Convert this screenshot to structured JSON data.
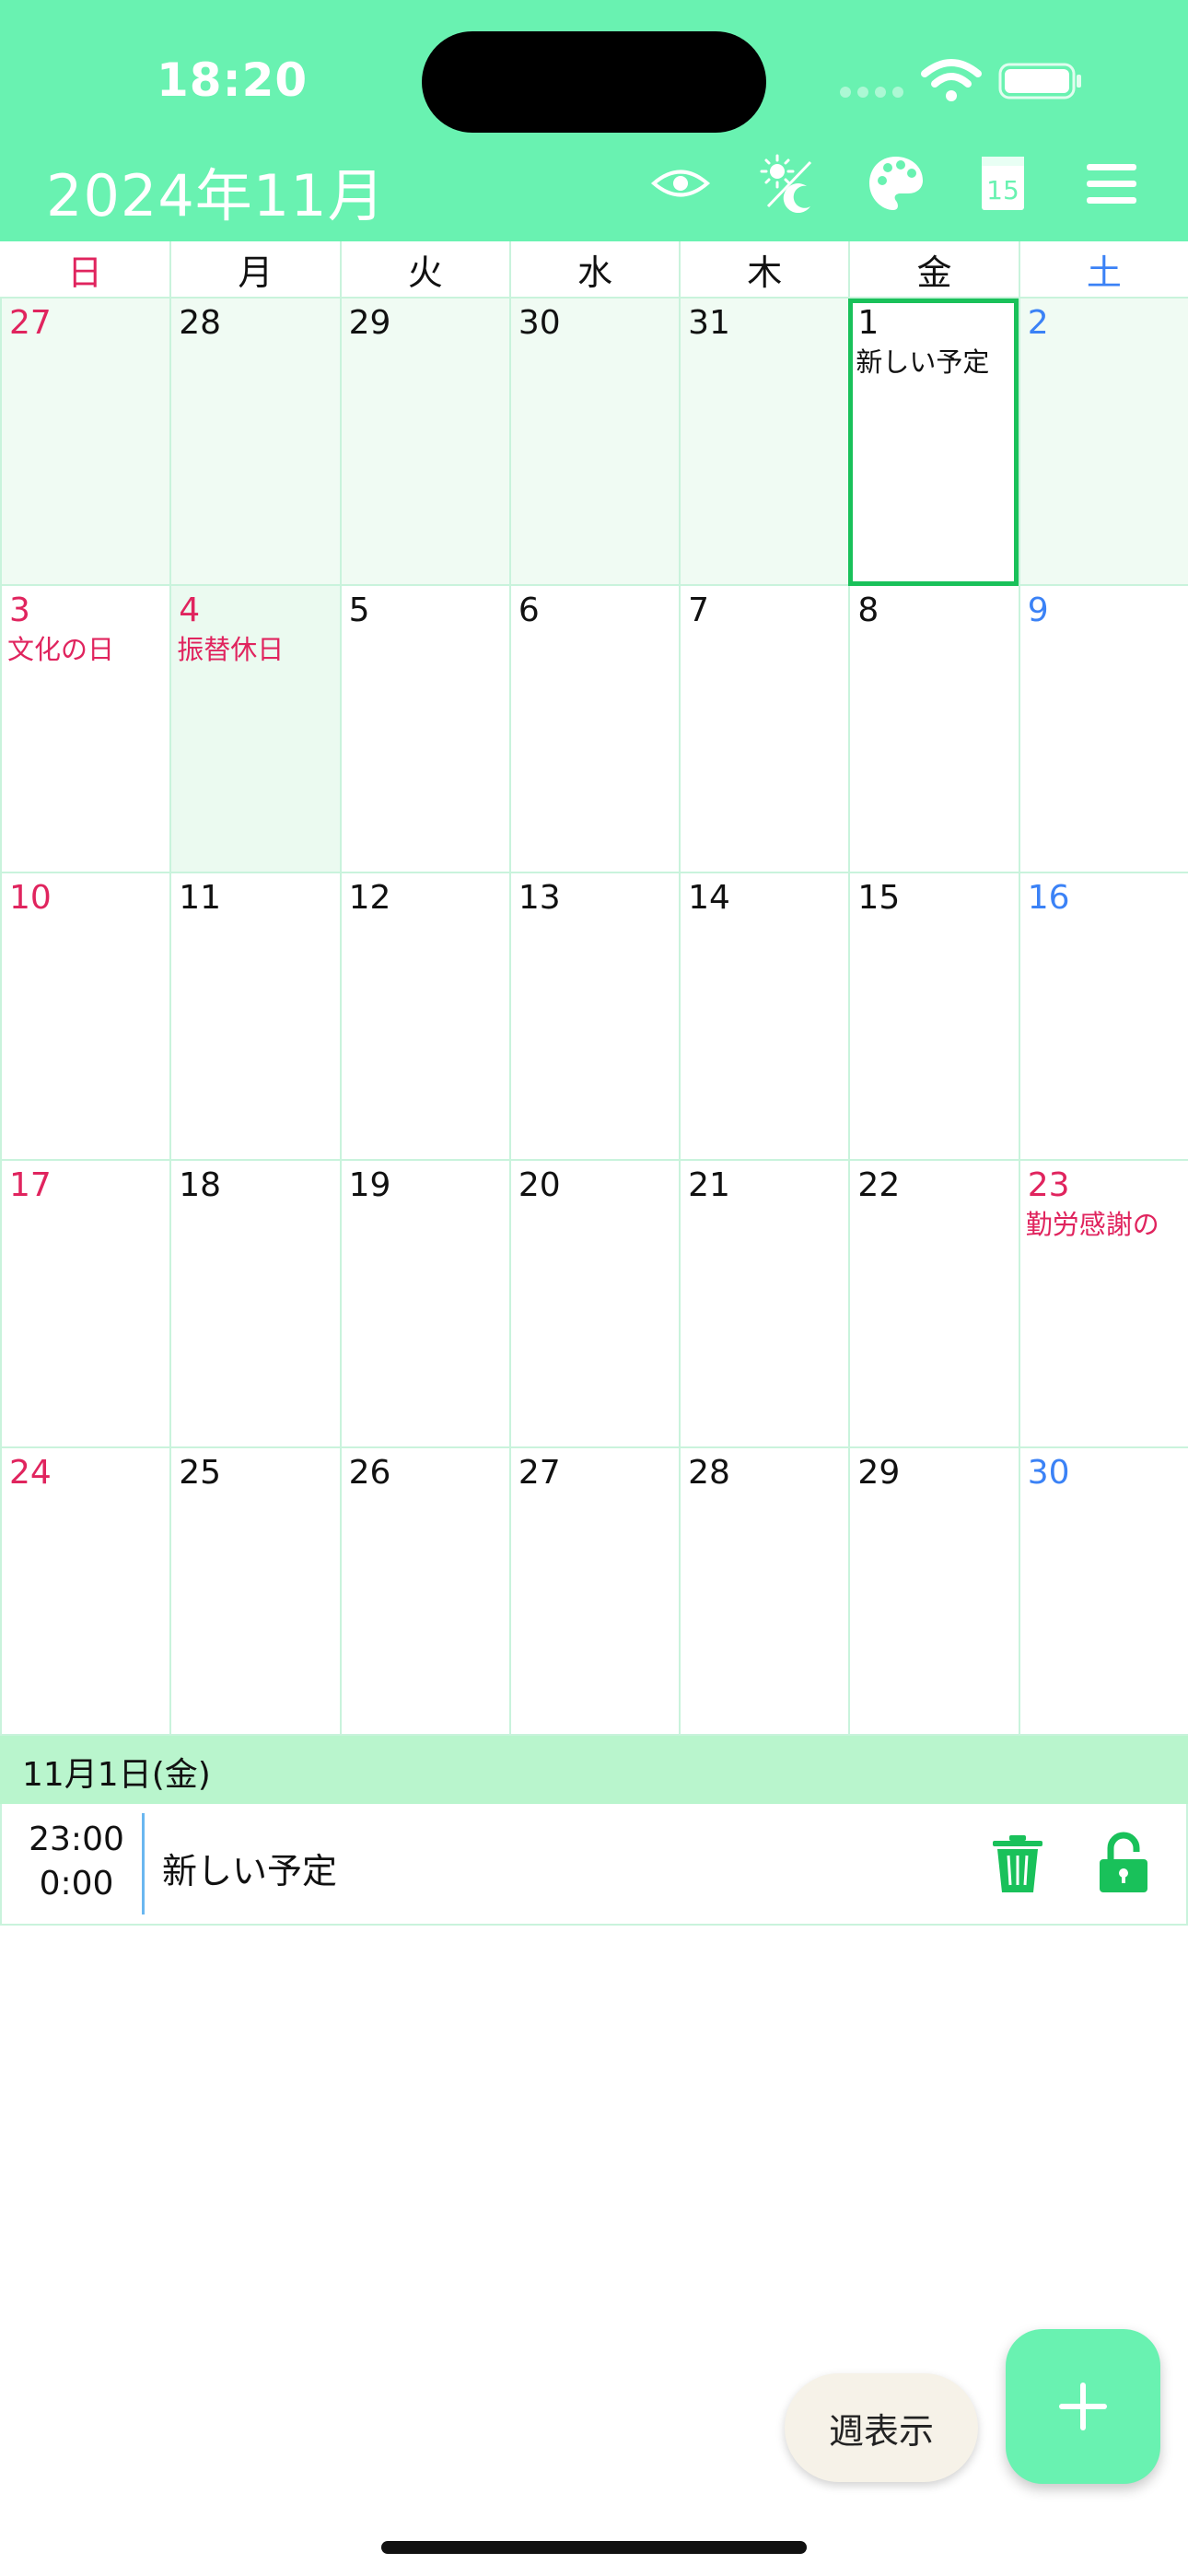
{
  "status_bar": {
    "time": "18:20"
  },
  "header": {
    "title": "2024年11月",
    "icons": [
      "eye-icon",
      "theme-toggle-icon",
      "palette-icon",
      "calendar-15-icon",
      "menu-icon"
    ],
    "calendar_icon_text": "15",
    "background_color": "#69f2b1"
  },
  "weekdays": [
    "日",
    "月",
    "火",
    "水",
    "木",
    "金",
    "土"
  ],
  "calendar": {
    "selected_date": "2024-11-01",
    "weeks": [
      [
        {
          "day": "27",
          "muted": true
        },
        {
          "day": "28",
          "muted": true
        },
        {
          "day": "29",
          "muted": true
        },
        {
          "day": "30",
          "muted": true
        },
        {
          "day": "31",
          "muted": true
        },
        {
          "day": "1",
          "muted": false,
          "selected": true,
          "event": "新しい予定"
        },
        {
          "day": "2",
          "muted": true
        }
      ],
      [
        {
          "day": "3",
          "holiday": true,
          "event": "文化の日"
        },
        {
          "day": "4",
          "holiday": true,
          "holiday_bg": true,
          "event": "振替休日"
        },
        {
          "day": "5"
        },
        {
          "day": "6"
        },
        {
          "day": "7"
        },
        {
          "day": "8"
        },
        {
          "day": "9"
        }
      ],
      [
        {
          "day": "10"
        },
        {
          "day": "11"
        },
        {
          "day": "12"
        },
        {
          "day": "13"
        },
        {
          "day": "14"
        },
        {
          "day": "15"
        },
        {
          "day": "16"
        }
      ],
      [
        {
          "day": "17"
        },
        {
          "day": "18"
        },
        {
          "day": "19"
        },
        {
          "day": "20"
        },
        {
          "day": "21"
        },
        {
          "day": "22"
        },
        {
          "day": "23",
          "holiday": true,
          "event": "勤労感謝の"
        }
      ],
      [
        {
          "day": "24"
        },
        {
          "day": "25"
        },
        {
          "day": "26"
        },
        {
          "day": "27"
        },
        {
          "day": "28"
        },
        {
          "day": "29"
        },
        {
          "day": "30"
        }
      ]
    ]
  },
  "detail": {
    "date_label": "11月1日(金)",
    "events": [
      {
        "start": "23:00",
        "end": "0:00",
        "title": "新しい予定"
      }
    ]
  },
  "buttons": {
    "week_view": "週表示",
    "add": "+"
  },
  "colors": {
    "accent": "#69f2b1",
    "sunday": "#e0245e",
    "saturday": "#3b82f6",
    "action_green": "#19c15a"
  }
}
